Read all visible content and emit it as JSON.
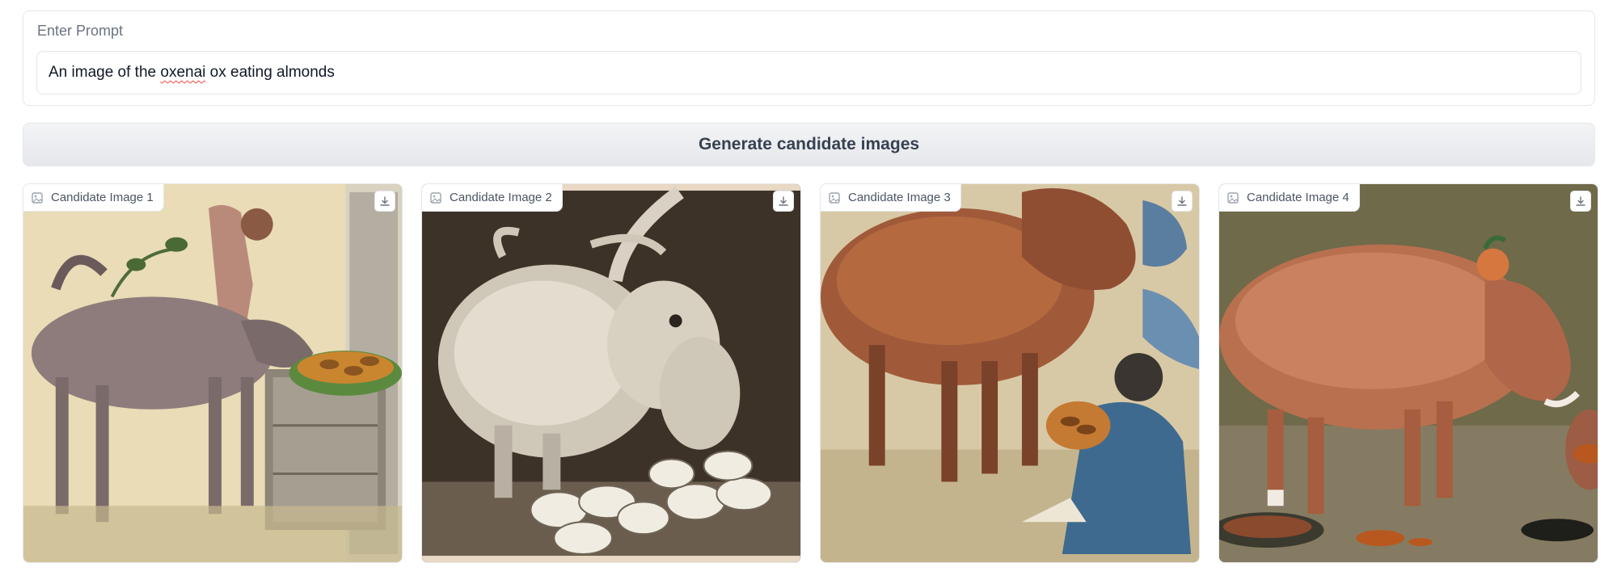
{
  "prompt": {
    "label": "Enter Prompt",
    "value_before": "An image of the ",
    "value_misspelled": "oxenai",
    "value_after": " ox eating almonds"
  },
  "generate_button": {
    "label": "Generate candidate images"
  },
  "candidates": [
    {
      "label": "Candidate Image 1"
    },
    {
      "label": "Candidate Image 2"
    },
    {
      "label": "Candidate Image 3"
    },
    {
      "label": "Candidate Image 4"
    }
  ]
}
